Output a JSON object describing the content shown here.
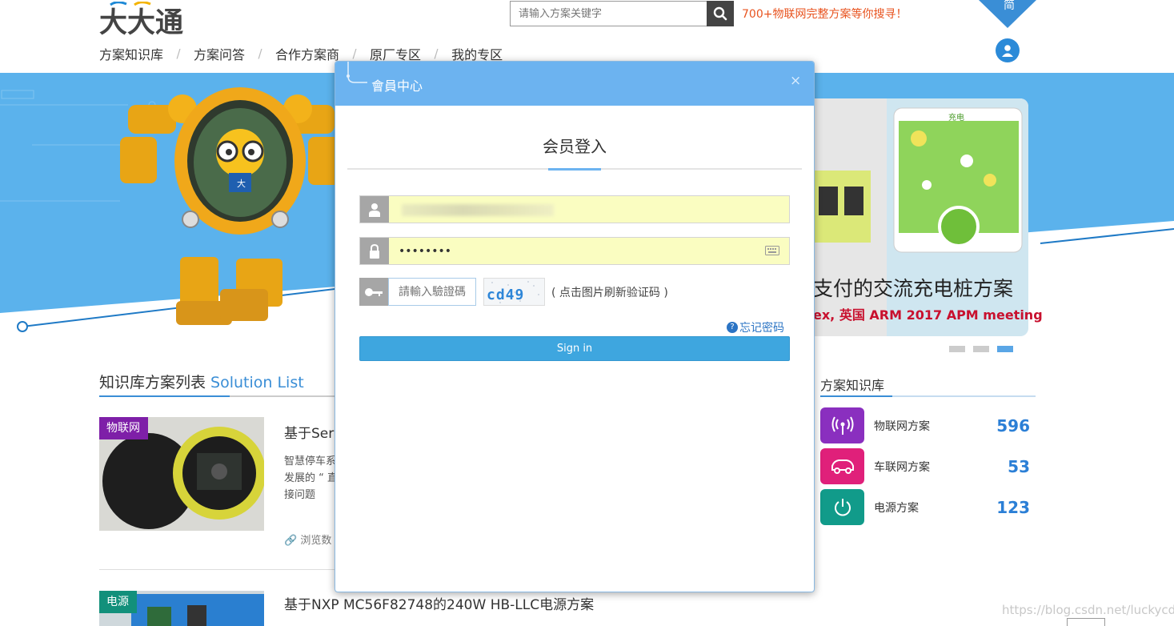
{
  "header": {
    "logo_text": "大大通",
    "search_placeholder": "请输入方案关键字",
    "search_tagline": "700+物联网完整方案等你搜寻！",
    "lang_label": "简"
  },
  "nav": {
    "items": [
      "方案知识库",
      "方案问答",
      "合作方案商",
      "原厂专区",
      "我的专区"
    ]
  },
  "banner": {
    "title": "支付的交流充电桩方案",
    "subtitle": "ex, 英国 ARM 2017 APM meeting",
    "phone_header": "充电",
    "robot_badge": "大",
    "slider": {
      "count": 3,
      "active_index": 2
    }
  },
  "solution_list": {
    "heading_zh": "知识库方案列表",
    "heading_en": "Solution List",
    "articles": [
      {
        "tag": "物联网",
        "title": "基于Ser",
        "desc": "智慧停车系 发展的 “ 直接问题",
        "views_label": "浏览数"
      },
      {
        "tag": "电源",
        "title": "基于NXP MC56F82748的240W HB-LLC电源方案"
      }
    ]
  },
  "knowledge_base": {
    "heading": "方案知识库",
    "items": [
      {
        "label": "物联网方案",
        "count": "596",
        "color": "#8a2fbf",
        "icon": "antenna-icon"
      },
      {
        "label": "车联网方案",
        "count": "53",
        "color": "#e0207a",
        "icon": "car-icon"
      },
      {
        "label": "电源方案",
        "count": "123",
        "color": "#119b8a",
        "icon": "power-icon"
      }
    ]
  },
  "modal": {
    "title": "會員中心",
    "close_label": "×",
    "login_heading": "会员登入",
    "username_value": "",
    "password_value": "••••••••",
    "captcha_placeholder": "請輸入驗證碼",
    "captcha_code": "cd49",
    "captcha_hint": "( 点击图片刷新验证码 )",
    "forgot_label": "忘记密码",
    "signin_label": "Sign in"
  },
  "watermark": "https://blog.csdn.net/luckycdy",
  "colors": {
    "accent_blue": "#6cb3f0",
    "tagline_orange": "#e8531f",
    "input_yellow": "#fafdc1",
    "signin_blue": "#3ea6df"
  }
}
